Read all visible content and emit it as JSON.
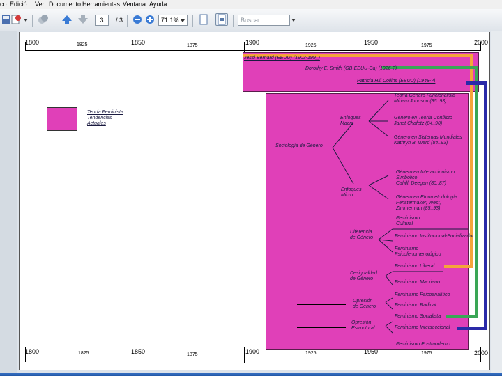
{
  "menu": [
    "co",
    "Edició",
    "Ver",
    "Documento",
    "Herramientas",
    "Ventana",
    "Ayuda"
  ],
  "toolbar": {
    "page_current": "3",
    "page_total": "/ 3",
    "zoom": "71.1%",
    "search_placeholder": "Buscar"
  },
  "timeline": {
    "top_major": [
      "1800",
      "1850",
      "1900",
      "1950",
      "2000"
    ],
    "top_minor": [
      "1825",
      "1875",
      "1925",
      "1975"
    ],
    "bottom_major": [
      "1800",
      "1850",
      "1900",
      "1950",
      "2000"
    ],
    "bottom_minor": [
      "1825",
      "1875",
      "1925",
      "1975"
    ]
  },
  "authors": [
    "Jessi Bernard (EEUU) (1903-199_)",
    "Dorothy E. Smith (GB-EEUU-Ca) (1926-?)",
    "Patricia Hill Collins (EEUU) (1948-?)"
  ],
  "legend": [
    "Teoría Feminista",
    "Tendencias",
    "Actuales"
  ],
  "tree": {
    "root": "Sociología de Género",
    "macro": [
      "Enfoques",
      "Macro"
    ],
    "micro": [
      "Enfoques",
      "Micro"
    ],
    "diferencia": [
      "Diferencia",
      "de Género"
    ],
    "desigualdad": [
      "Desigualdad",
      "de Género"
    ],
    "opresion_genero": [
      "Opresión",
      "de Género"
    ],
    "opresion_estructural": [
      "Opresión",
      "Estructural"
    ],
    "leaves": {
      "funcionalista": [
        "Teoría Género Funcionalista",
        "Miriam Johnson (85..93)"
      ],
      "conflicto": [
        "Género en Teoría Conflicto",
        "Janet Chafetz (84..90)"
      ],
      "sistemas": [
        "Género en Sistemas Mundiales",
        "Kathryn B. Ward (84..93)"
      ],
      "interaccionismo": [
        "Género en Interaccionismo",
        "Simbólico",
        "Cahill, Deegan (80..87)"
      ],
      "etnometodologia": [
        "Género en Etnometodología",
        "Fenstermaker, West,",
        "Zimmerman (85..93)"
      ],
      "cultural": [
        "Feminismo",
        "Cultural"
      ],
      "institucional": "Feminismo Institucional-Socializador",
      "psicoanalitico_dif": [
        "Feminismo",
        "Psicofenomenológico"
      ],
      "liberal": "Feminismo Liberal",
      "marxiano": "Feminismo Marxiano",
      "psicoanalitico": "Feminismo Psicoanalítico",
      "radical": "Feminismo Radical",
      "socialista": "Feminismo Socialista",
      "interseccional": "Feminismo Interseccional",
      "posmoderno": "Feminismo Postmoderno"
    }
  },
  "colors": {
    "pink": "#e040b8",
    "orange": "#f5a53a",
    "green": "#3aa655",
    "navy": "#2a2aa8"
  }
}
